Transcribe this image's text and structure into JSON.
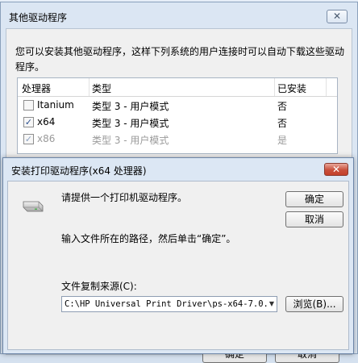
{
  "background_dialog": {
    "title": "其他驱动程序",
    "description": "您可以安装其他驱动程序，这样下列系统的用户连接时可以自动下载这些驱动程序。",
    "columns": [
      "处理器",
      "类型",
      "已安装"
    ],
    "rows": [
      {
        "checked": false,
        "processor": "Itanium",
        "type": "类型 3 - 用户模式",
        "installed": "否",
        "disabled": false
      },
      {
        "checked": true,
        "processor": "x64",
        "type": "类型 3 - 用户模式",
        "installed": "否",
        "disabled": false
      },
      {
        "checked": true,
        "processor": "x86",
        "type": "类型 3 - 用户模式",
        "installed": "是",
        "disabled": true
      }
    ],
    "bottom_buttons": [
      "确定",
      "取消"
    ]
  },
  "install_dialog": {
    "title": "安装打印驱动程序(x64 处理器)",
    "prompt": "请提供一个打印机驱动程序。",
    "path_hint": "输入文件所在的路径，然后单击“确定”。",
    "copy_from_label": "文件复制来源(C):",
    "copy_from_value": "C:\\HP Universal Print Driver\\ps-x64-7.0.",
    "ok_label": "确定",
    "cancel_label": "取消",
    "browse_label": "浏览(B)..."
  },
  "icons": {
    "close": "close-icon",
    "printer": "printer-drive-icon",
    "dropdown": "chevron-down-icon"
  }
}
